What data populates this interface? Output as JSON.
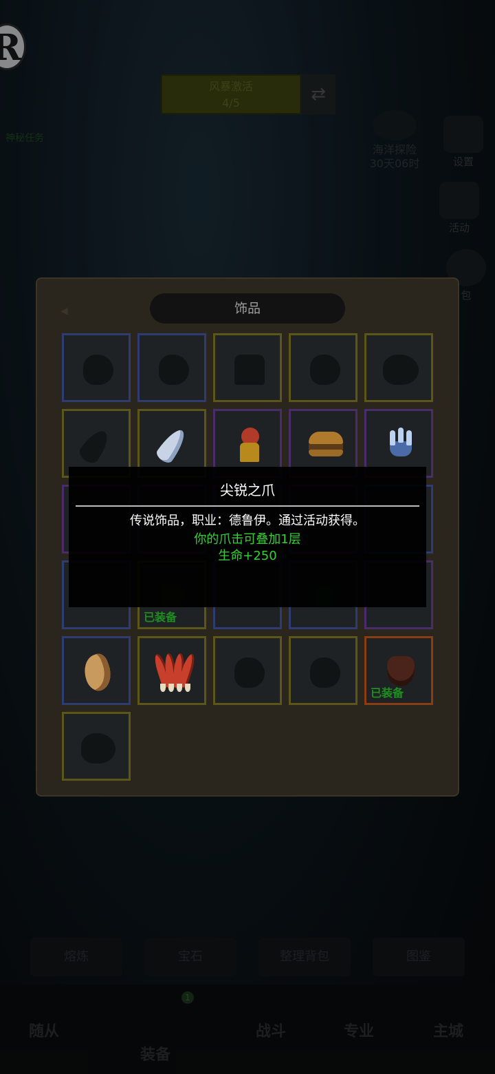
{
  "background": {
    "wind_box_title": "风暴激活",
    "wind_box_count": "4/5",
    "left_note": "神秘任务",
    "sea_event_label": "海洋探险",
    "sea_event_timer": "30天06时",
    "settings_label": "设置",
    "activity_label": "活动",
    "bag_label": "包",
    "sub_buttons": [
      "熔炼",
      "宝石",
      "整理背包",
      "图鉴"
    ],
    "bottom_tabs": [
      "随从",
      "装备",
      "战斗",
      "专业",
      "主城"
    ],
    "equip_badge": "1"
  },
  "panel": {
    "title": "饰品",
    "equipped_label": "已装备"
  },
  "tooltip": {
    "name": "尖锐之爪",
    "description": "传说饰品，职业：德鲁伊。通过活动获得。",
    "effect_1": "你的爪击可叠加1层",
    "effect_2": "生命+250"
  },
  "colors": {
    "quality_blue": "#2e3c72",
    "quality_yellow": "#5c5618",
    "quality_purple": "#4b2c6a",
    "quality_orange": "#8a3d12",
    "effect_green": "#34d134"
  }
}
